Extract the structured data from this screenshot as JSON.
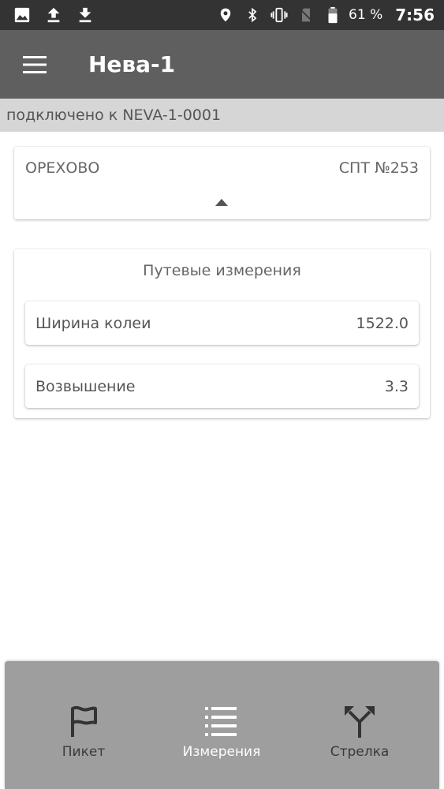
{
  "status_bar": {
    "battery_percent": "61 %",
    "time": "7:56",
    "icons_left": [
      "image-icon",
      "upload-icon",
      "download-icon"
    ],
    "icons_right": [
      "location-icon",
      "bluetooth-icon",
      "vibrate-icon",
      "no-sim-icon",
      "battery-icon"
    ]
  },
  "app_bar": {
    "title": "Нева-1"
  },
  "connection": {
    "status": "подключено к NEVA-1-0001"
  },
  "location_card": {
    "station": "ОРЕХОВО",
    "switch_post": "СПТ №253"
  },
  "measurements": {
    "title": "Путевые измерения",
    "items": [
      {
        "label": "Ширина колеи",
        "value": "1522.0"
      },
      {
        "label": "Возвышение",
        "value": "3.3"
      }
    ]
  },
  "bottom_nav": {
    "items": [
      {
        "label": "Пикет",
        "icon": "flag-icon",
        "active": false
      },
      {
        "label": "Измерения",
        "icon": "list-icon",
        "active": true
      },
      {
        "label": "Стрелка",
        "icon": "fork-icon",
        "active": false
      }
    ]
  },
  "colors": {
    "status_bar": "#333333",
    "app_bar": "#5f5f5f",
    "banner": "#d6d6d6",
    "bottom_nav": "#9e9e9e"
  }
}
